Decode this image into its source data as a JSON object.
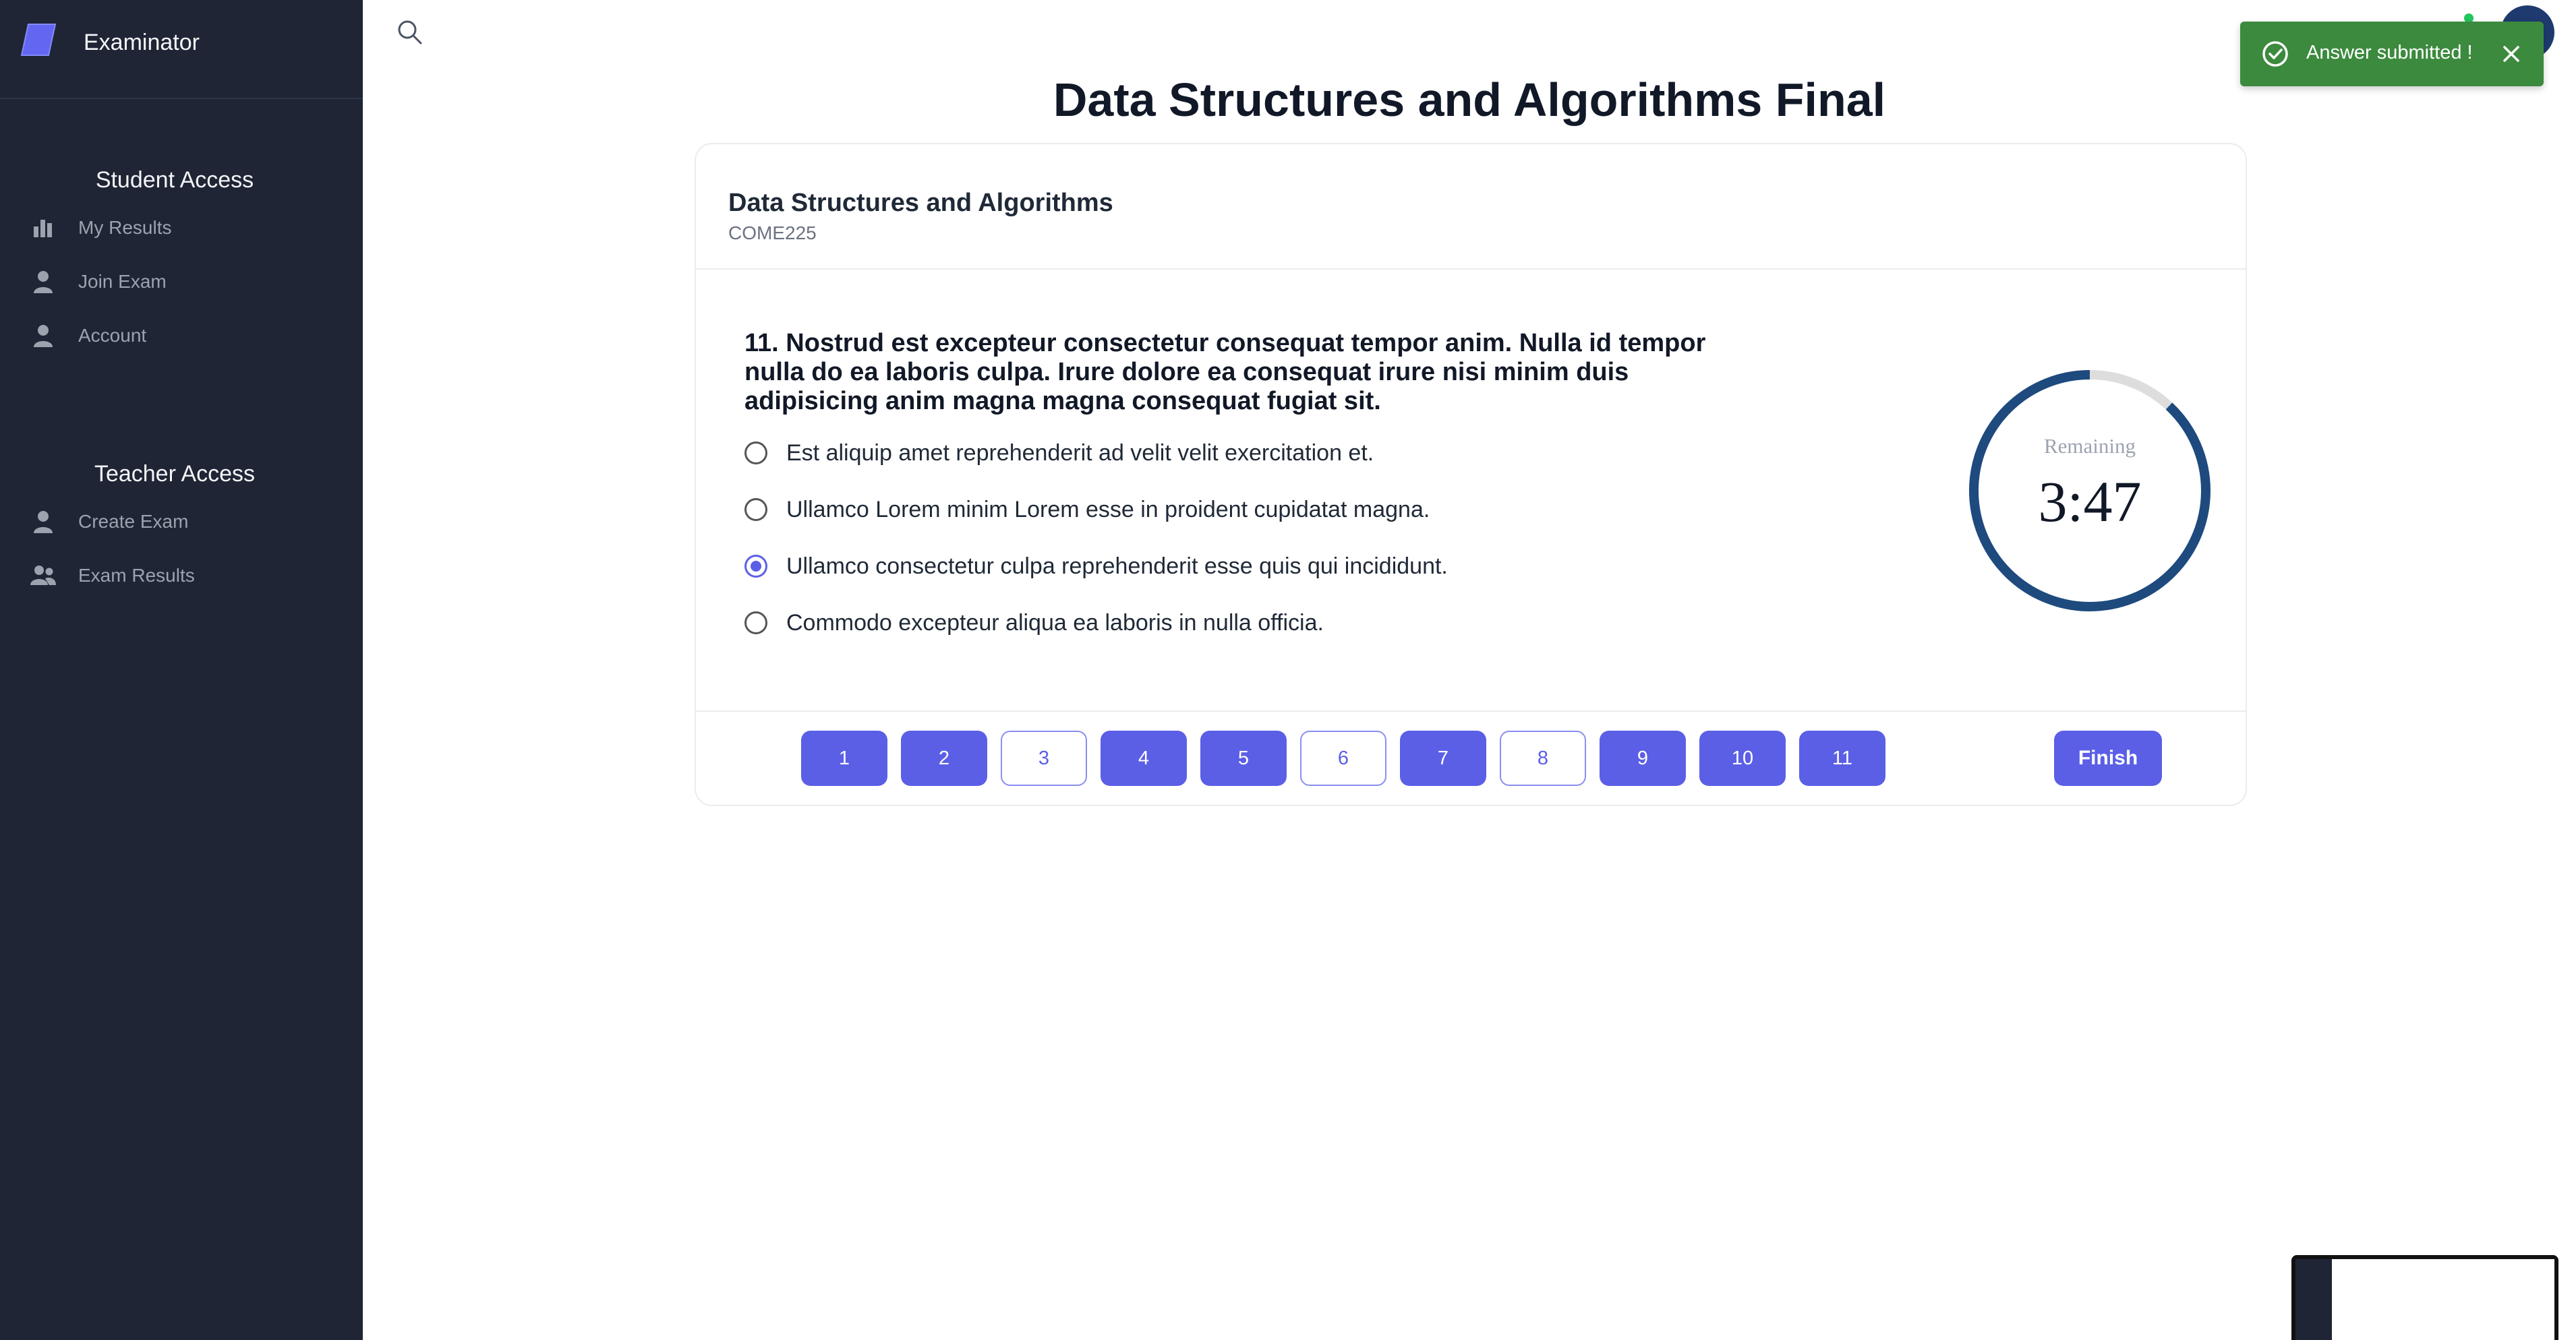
{
  "app": {
    "name": "Examinator"
  },
  "sidebar": {
    "student_title": "Student Access",
    "student_items": [
      {
        "label": "My Results",
        "icon": "bar-chart-icon"
      },
      {
        "label": "Join Exam",
        "icon": "user-icon"
      },
      {
        "label": "Account",
        "icon": "user-icon"
      }
    ],
    "teacher_title": "Teacher Access",
    "teacher_items": [
      {
        "label": "Create Exam",
        "icon": "user-icon"
      },
      {
        "label": "Exam Results",
        "icon": "users-icon"
      }
    ]
  },
  "toast": {
    "message": "Answer submitted !",
    "color": "#3c8a3e"
  },
  "exam": {
    "title": "Data Structures and Algorithms Final",
    "course_name": "Data Structures and Algorithms",
    "course_code": "COME225"
  },
  "question": {
    "text": "11. Nostrud est excepteur consectetur consequat tempor anim. Nulla id tempor nulla do ea laboris culpa. Irure dolore ea consequat irure nisi minim duis adipisicing anim magna magna consequat fugiat sit.",
    "options": [
      {
        "label": "Est aliquip amet reprehenderit ad velit velit exercitation et.",
        "selected": false
      },
      {
        "label": "Ullamco Lorem minim Lorem esse in proident cupidatat magna.",
        "selected": false
      },
      {
        "label": "Ullamco consectetur culpa reprehenderit esse quis qui incididunt.",
        "selected": true
      },
      {
        "label": "Commodo excepteur aliqua ea laboris in nulla officia.",
        "selected": false
      }
    ]
  },
  "timer": {
    "label": "Remaining",
    "value": "3:47",
    "remaining_fraction": 0.88,
    "color": "#1e4a7e"
  },
  "navigation": {
    "questions": [
      {
        "label": "1",
        "answered": true
      },
      {
        "label": "2",
        "answered": true
      },
      {
        "label": "3",
        "answered": false
      },
      {
        "label": "4",
        "answered": true
      },
      {
        "label": "5",
        "answered": true
      },
      {
        "label": "6",
        "answered": false
      },
      {
        "label": "7",
        "answered": true
      },
      {
        "label": "8",
        "answered": false
      },
      {
        "label": "9",
        "answered": true
      },
      {
        "label": "10",
        "answered": true
      },
      {
        "label": "11",
        "answered": true
      }
    ],
    "finish_label": "Finish"
  },
  "colors": {
    "accent": "#5b5fe6",
    "sidebar": "#1f2535"
  }
}
